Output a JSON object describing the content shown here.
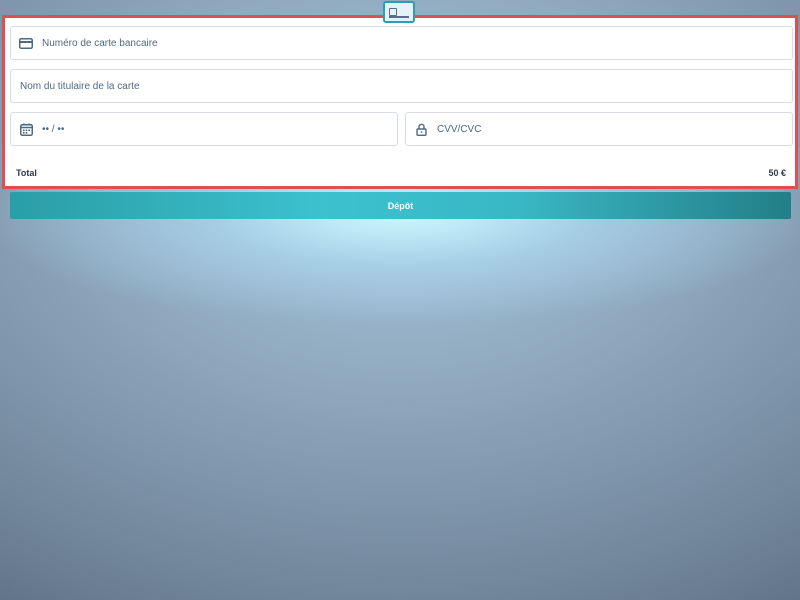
{
  "header": {
    "icon": "credit-card-icon"
  },
  "form": {
    "card_number": {
      "placeholder": "Numéro de carte bancaire",
      "icon": "credit-card-icon"
    },
    "holder_name": {
      "placeholder": "Nom du titulaire de la carte"
    },
    "expiry": {
      "placeholder": "•• / ••",
      "icon": "calendar-icon"
    },
    "cvv": {
      "placeholder": "CVV/CVC",
      "icon": "lock-icon"
    },
    "total": {
      "label": "Total",
      "amount": "50 €"
    }
  },
  "actions": {
    "deposit_label": "Dépôt"
  },
  "colors": {
    "accent": "#2a9fb1",
    "highlight_border": "#e04e55",
    "button_gradient": [
      "#2a9ea6",
      "#3cc1cf",
      "#237f87"
    ]
  }
}
